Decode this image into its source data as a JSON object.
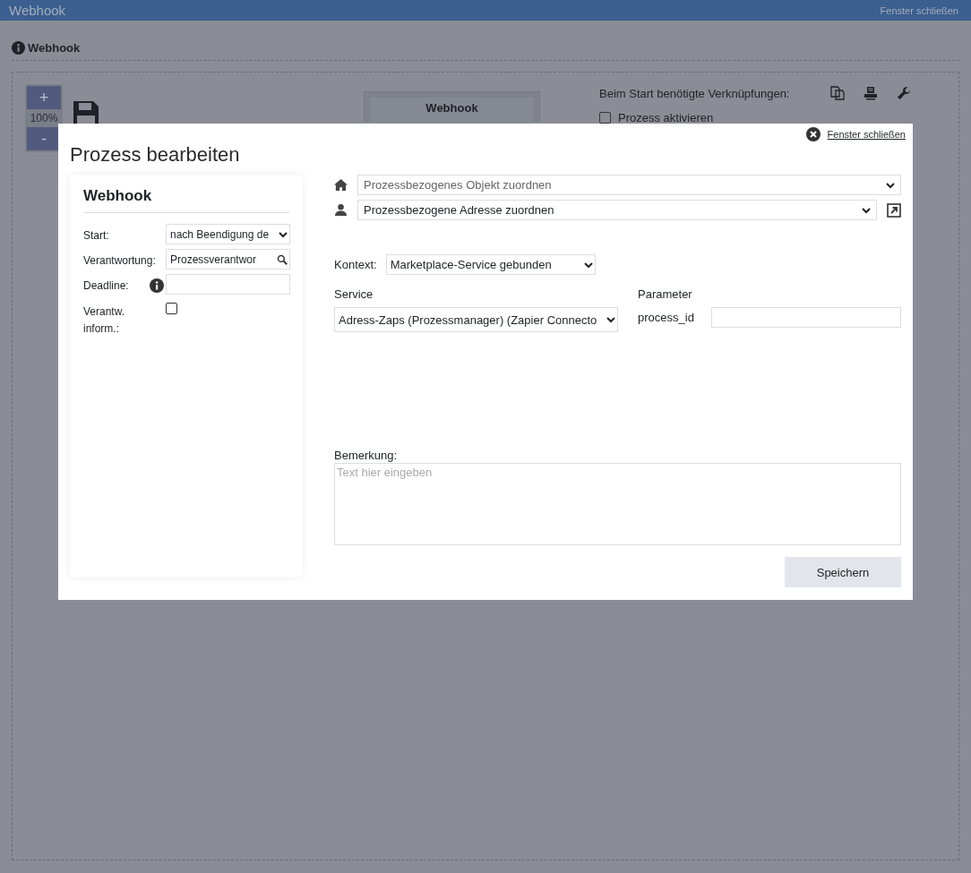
{
  "window": {
    "title": "Webhook",
    "close_link": "Fenster schließen"
  },
  "page": {
    "heading": "Webhook",
    "zoom": {
      "plus": "+",
      "level": "100%",
      "minus": "-"
    },
    "node_title": "Webhook",
    "links_label": "Beim Start benötigte Verknüpfungen:",
    "activate": {
      "label": "Prozess aktivieren",
      "checked": false
    }
  },
  "dialog": {
    "title": "Prozess bearbeiten",
    "close_link": "Fenster schließen",
    "card": {
      "title": "Webhook",
      "fields": [
        {
          "kind": "select",
          "label": "Start:",
          "value": "nach Beendigung de"
        },
        {
          "kind": "search",
          "label": "Verantwortung:",
          "value": "Prozessverantwor"
        },
        {
          "kind": "input",
          "label": "Deadline:",
          "info": true
        },
        {
          "kind": "checkbox",
          "label": "Verantw. inform.:",
          "checked": false
        }
      ]
    },
    "object_select": {
      "placeholder": "Prozessbezogenes Objekt zuordnen"
    },
    "address_select": {
      "value": "Prozessbezogene Adresse zuordnen"
    },
    "context": {
      "label": "Kontext:",
      "value": "Marketplace-Service gebunden"
    },
    "service": {
      "label": "Service",
      "value": "Adress-Zaps (Prozessmanager) (Zapier Connecto"
    },
    "parameters": {
      "label": "Parameter",
      "items": [
        {
          "name": "process_id"
        }
      ]
    },
    "remark": {
      "label": "Bemerkung:",
      "placeholder": "Text hier eingeben"
    },
    "save_button": "Speichern"
  }
}
